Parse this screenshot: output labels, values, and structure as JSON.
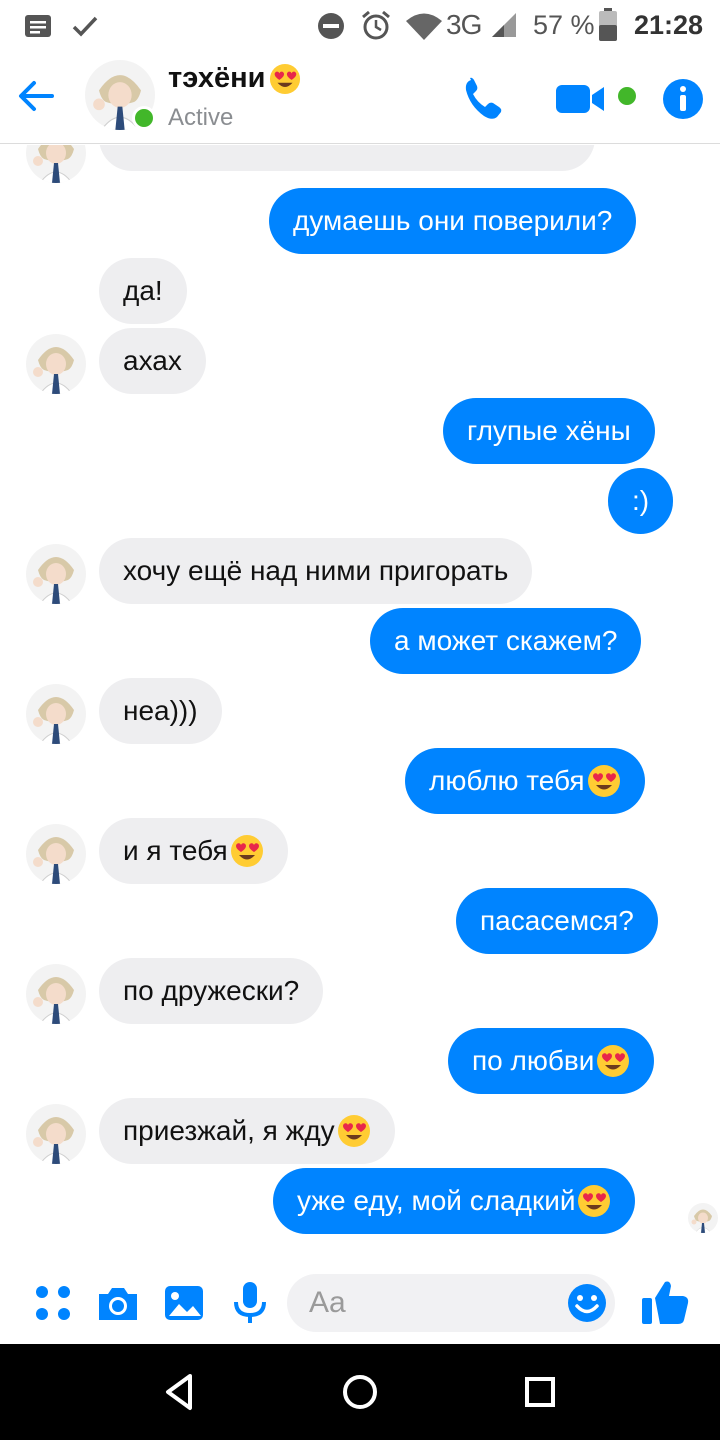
{
  "status_bar": {
    "network": "3G",
    "battery_percent": "57 %",
    "time": "21:28"
  },
  "header": {
    "contact_name": "тэхёни",
    "contact_name_emoji": "heart-eyes-emoji",
    "status": "Active"
  },
  "messages": [
    {
      "side": "in",
      "text": "да!",
      "emoji": false
    },
    {
      "side": "in",
      "text": "ахах",
      "emoji": false
    },
    {
      "side": "out",
      "text": "думаешь они поверили?",
      "emoji": false
    },
    {
      "side": "out",
      "text": "глупые хёны",
      "emoji": false
    },
    {
      "side": "out",
      "text": ":)",
      "emoji": false
    },
    {
      "side": "in",
      "text": "хочу ещё над ними пригорать",
      "emoji": false
    },
    {
      "side": "out",
      "text": "а может скажем?",
      "emoji": false
    },
    {
      "side": "in",
      "text": "неа)))",
      "emoji": false
    },
    {
      "side": "out",
      "text": "люблю тебя ",
      "emoji": true
    },
    {
      "side": "in",
      "text": "и я тебя",
      "emoji": true
    },
    {
      "side": "out",
      "text": "пасасемся?",
      "emoji": false
    },
    {
      "side": "in",
      "text": "по дружески?",
      "emoji": false
    },
    {
      "side": "out",
      "text": "по любви",
      "emoji": true
    },
    {
      "side": "in",
      "text": "приезжай, я жду",
      "emoji": true
    },
    {
      "side": "out",
      "text": "уже еду, мой сладкий",
      "emoji": true
    }
  ],
  "composer": {
    "placeholder": "Aa"
  },
  "colors": {
    "accent": "#0084ff",
    "incoming_bubble": "#eeeef0",
    "active_green": "#42b72a"
  },
  "icons": [
    "back-arrow-icon",
    "phone-icon",
    "video-camera-icon",
    "info-icon",
    "apps-grid-icon",
    "camera-icon",
    "image-icon",
    "microphone-icon",
    "smiley-icon",
    "thumbs-up-icon"
  ]
}
